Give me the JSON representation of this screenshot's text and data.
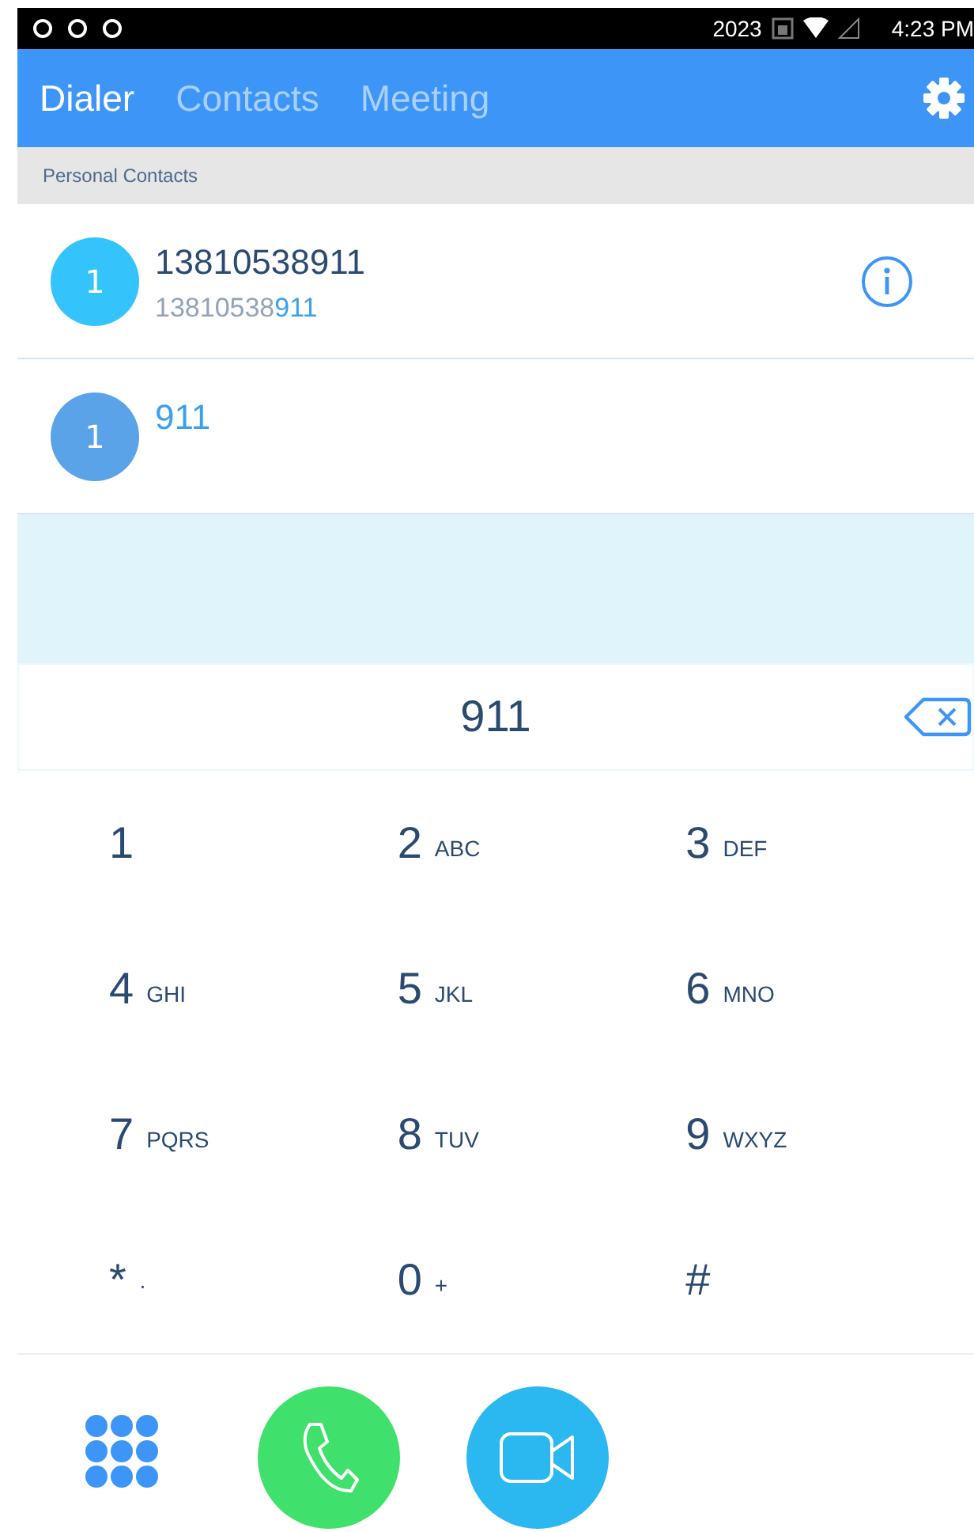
{
  "status_bar": {
    "text": "2023",
    "time": "4:23 PM"
  },
  "tabs": [
    {
      "label": "Dialer",
      "selected": true
    },
    {
      "label": "Contacts",
      "selected": false
    },
    {
      "label": "Meeting",
      "selected": false
    }
  ],
  "section_header": "Personal Contacts",
  "contacts": [
    {
      "avatar": "1",
      "color": "#35c3fc",
      "info": true,
      "name_parts": [
        {
          "text": "13810538911",
          "match": false
        }
      ],
      "number_parts": [
        {
          "text": "13810538",
          "match": false
        },
        {
          "text": "911",
          "match": true
        }
      ]
    },
    {
      "avatar": "1",
      "color": "#5aa3e8",
      "info": false,
      "name_parts": [
        {
          "text": "911",
          "match": true
        }
      ]
    }
  ],
  "dial_input": {
    "value": "911"
  },
  "keys": [
    {
      "digit": "1"
    },
    {
      "digit": "2",
      "letters": "ABC"
    },
    {
      "digit": "3",
      "letters": "DEF"
    },
    {
      "digit": "4",
      "letters": "GHI"
    },
    {
      "digit": "5",
      "letters": "JKL"
    },
    {
      "digit": "6",
      "letters": "MNO"
    },
    {
      "digit": "7",
      "letters": "PQRS"
    },
    {
      "digit": "8",
      "letters": "TUV"
    },
    {
      "digit": "9",
      "letters": "WXYZ"
    },
    {
      "digit": "*",
      "letters": "·"
    },
    {
      "digit": "0",
      "letters": "+"
    },
    {
      "digit": "#"
    }
  ]
}
